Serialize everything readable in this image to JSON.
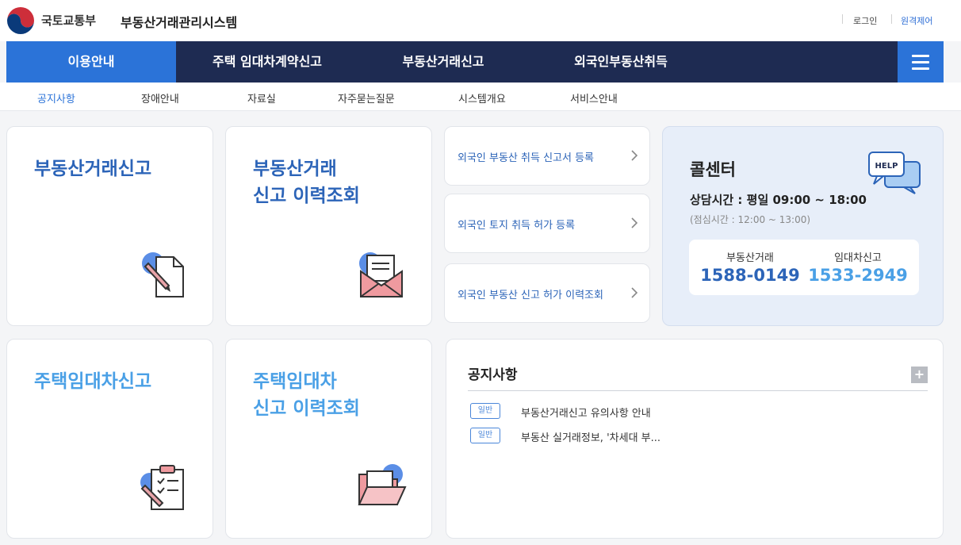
{
  "header": {
    "ministry": "국토교통부",
    "system_name": "부동산거래관리시스템",
    "util_links": [
      "로그인",
      "원격제어"
    ]
  },
  "main_nav": {
    "items": [
      "이용안내",
      "주택 임대차계약신고",
      "부동산거래신고",
      "외국인부동산취득"
    ],
    "active_index": 0
  },
  "sub_nav": {
    "items": [
      "공지사항",
      "장애안내",
      "자료실",
      "자주묻는질문",
      "시스템개요",
      "서비스안내"
    ],
    "active_index": 0
  },
  "cards": {
    "realestate_report": "부동산거래신고",
    "realestate_history": "부동산거래\n신고 이력조회",
    "lease_report": "주택임대차신고",
    "lease_history": "주택임대차\n신고 이력조회"
  },
  "foreign_links": [
    "외국인 부동산 취득 신고서 등록",
    "외국인 토지 취득 허가 등록",
    "외국인 부동산 신고 허가 이력조회"
  ],
  "call_center": {
    "title": "콜센터",
    "hours": "상담시간 : 평일 09:00 ~ 18:00",
    "lunch": "(점심시간 : 12:00 ~ 13:00)",
    "help_label": "HELP",
    "realestate_label": "부동산거래",
    "realestate_number": "1588-0149",
    "lease_label": "임대차신고",
    "lease_number": "1533-2949"
  },
  "notice": {
    "title": "공지사항",
    "more_label": "+",
    "items": [
      {
        "badge": "일반",
        "text": "부동산거래신고 유의사항 안내"
      },
      {
        "badge": "일반",
        "text": "부동산 실거래정보, '차세대 부..."
      }
    ]
  },
  "colors": {
    "nav_bg": "#1e2b52",
    "accent": "#2b73d8",
    "card_title_dark": "#2c64b8",
    "card_title_light": "#4aa0e6"
  }
}
